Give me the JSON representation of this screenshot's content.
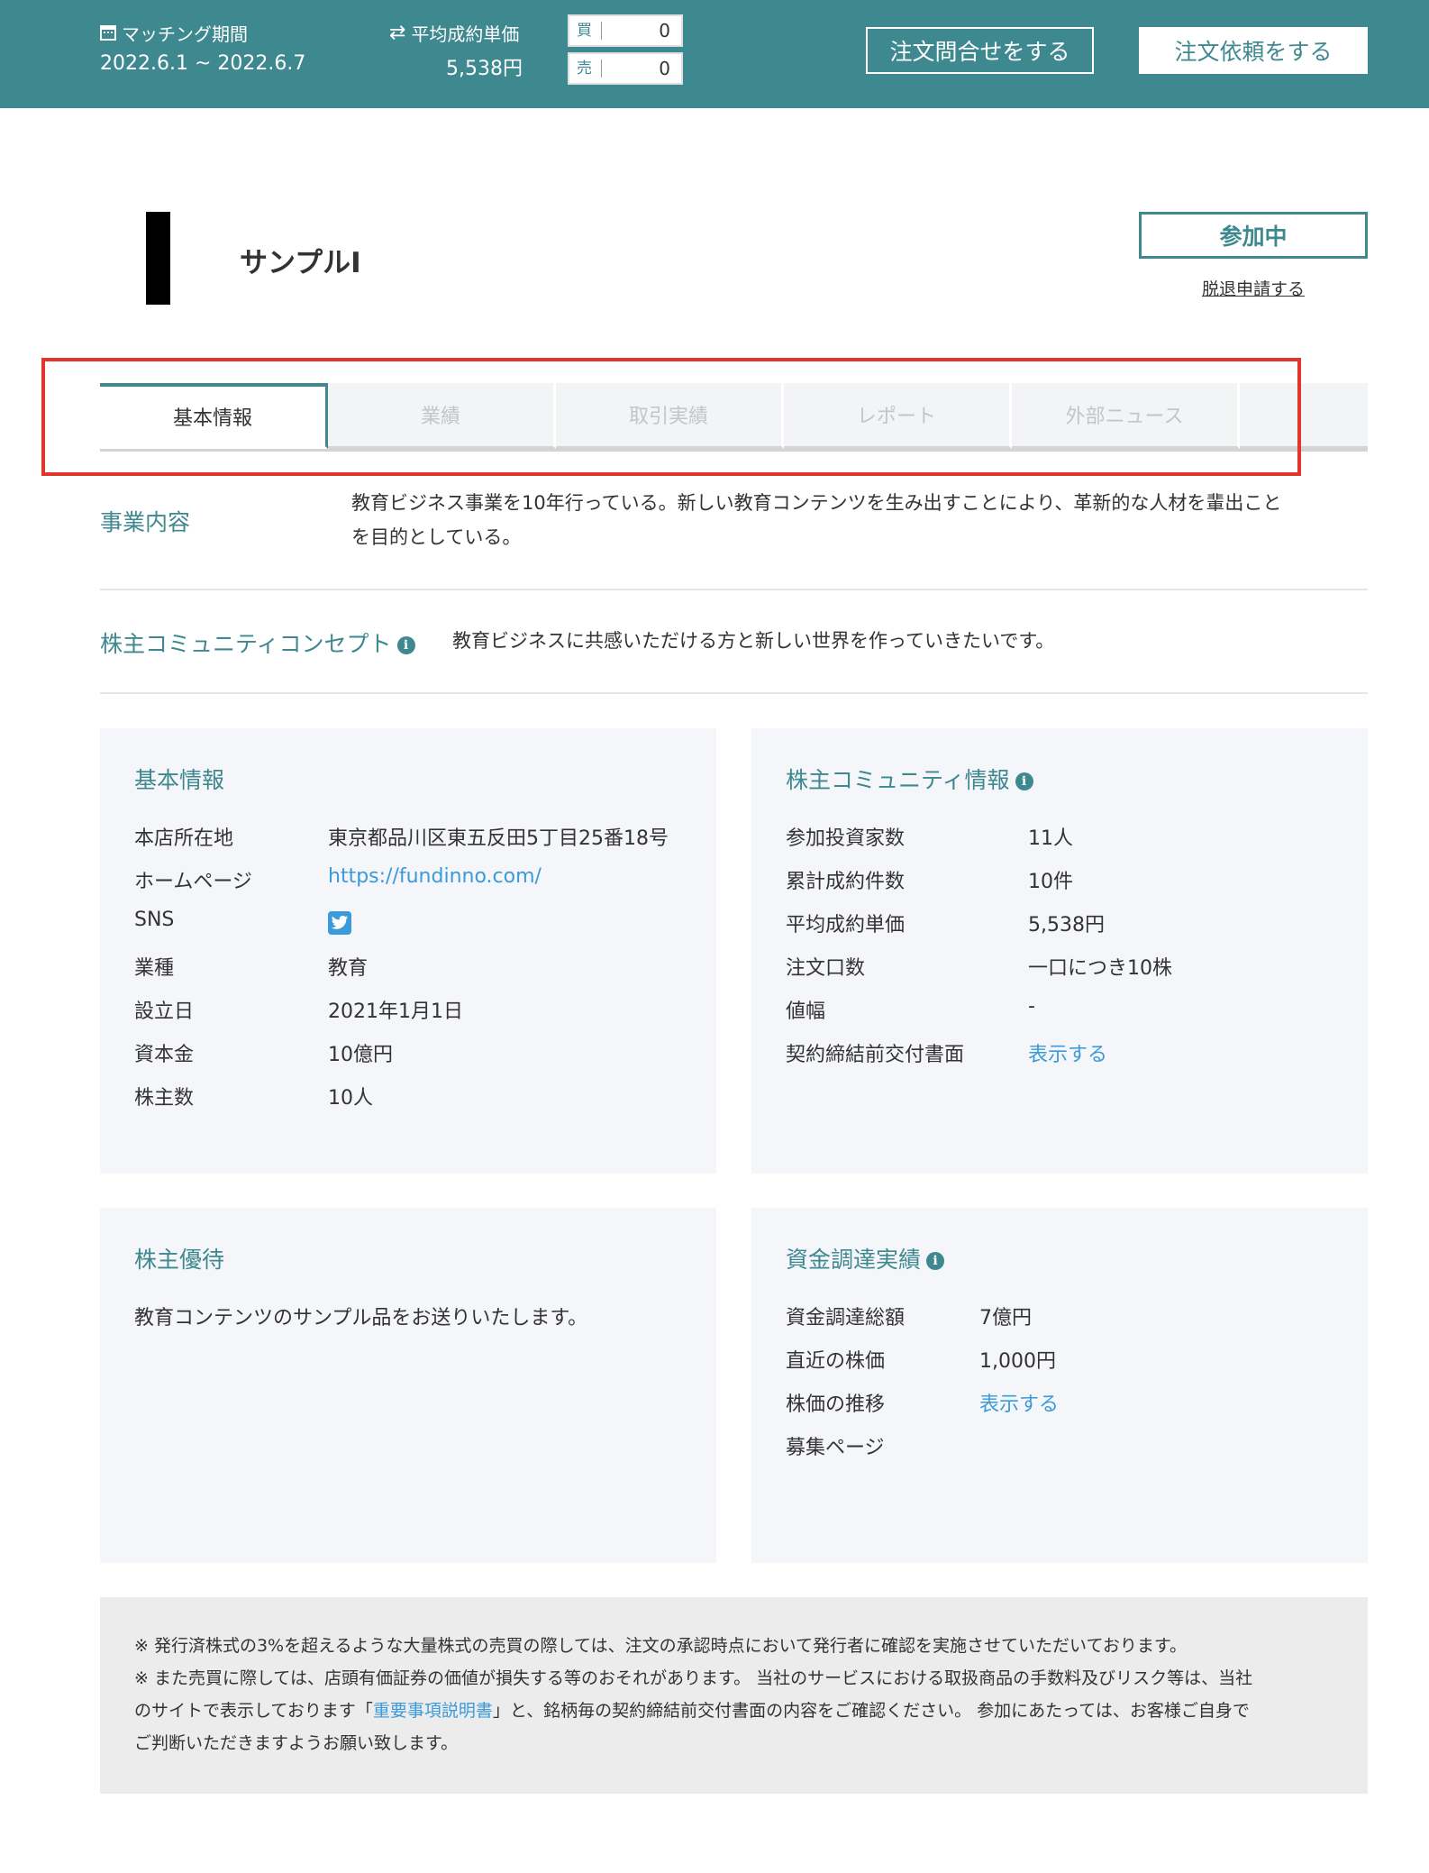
{
  "topbar": {
    "matching_label": "マッチング期間",
    "matching_value": "2022.6.1 ~ 2022.6.7",
    "avg_price_label": "平均成約単価",
    "avg_price_value": "5,538円",
    "buy_label": "買",
    "buy_value": "0",
    "sell_label": "売",
    "sell_value": "0",
    "inquiry_button": "注文問合せをする",
    "order_button": "注文依頼をする",
    "bg_color": "#3e8890"
  },
  "company": {
    "name": "サンプルI",
    "joined_button": "参加中",
    "withdraw_link": "脱退申請する"
  },
  "tabs": [
    {
      "label": "基本情報",
      "active": true
    },
    {
      "label": "業績",
      "active": false
    },
    {
      "label": "取引実績",
      "active": false
    },
    {
      "label": "レポート",
      "active": false
    },
    {
      "label": "外部ニュース",
      "active": false
    },
    {
      "label": "",
      "active": false
    }
  ],
  "business": {
    "label": "事業内容",
    "text_line1": "教育ビジネス事業を10年行っている。新しい教育コンテンツを生み出すことにより、革新的な人材を輩出こと",
    "text_line2": "を目的としている。"
  },
  "community_concept": {
    "label": "株主コミュニティコンセプト",
    "text": "教育ビジネスに共感いただける方と新しい世界を作っていきたいです。"
  },
  "basic_info": {
    "title": "基本情報",
    "rows": [
      {
        "key": "本店所在地",
        "value": "東京都品川区東五反田5丁目25番18号"
      },
      {
        "key": "ホームページ",
        "value": "https://fundinno.com/"
      },
      {
        "key": "SNS",
        "value": ""
      },
      {
        "key": "業種",
        "value": "教育"
      },
      {
        "key": "設立日",
        "value": "2021年1月1日"
      },
      {
        "key": "資本金",
        "value": "10億円"
      },
      {
        "key": "株主数",
        "value": "10人"
      }
    ]
  },
  "community_info": {
    "title": "株主コミュニティ情報",
    "rows": [
      {
        "key": "参加投資家数",
        "value": "11人"
      },
      {
        "key": "累計成約件数",
        "value": "10件"
      },
      {
        "key": "平均成約単価",
        "value": "5,538円"
      },
      {
        "key": "注文口数",
        "value": "一口につき10株"
      },
      {
        "key": "値幅",
        "value": "-"
      },
      {
        "key": "契約締結前交付書面",
        "value": "表示する"
      }
    ]
  },
  "benefits": {
    "title": "株主優待",
    "text": "教育コンテンツのサンプル品をお送りいたします。"
  },
  "funding": {
    "title": "資金調達実績",
    "rows": [
      {
        "key": "資金調達総額",
        "value": "7億円"
      },
      {
        "key": "直近の株価",
        "value": "1,000円"
      },
      {
        "key": "株価の推移",
        "value": "表示する"
      },
      {
        "key": "募集ページ",
        "value": ""
      }
    ]
  },
  "notice": {
    "line1": "※ 発行済株式の3%を超えるような大量株式の売買の際しては、注文の承認時点において発行者に確認を実施させていただいております。",
    "line2": "※ また売買に際しては、店頭有価証券の価値が損失する等のおそれがあります。 当社のサービスにおける取扱商品の手数料及びリスク等は、当社",
    "line3_pre": "のサイトで表示しております「",
    "line3_link": "重要事項説明書",
    "line3_post": "」と、銘柄毎の契約締結前交付書面の内容をご確認ください。 参加にあたっては、お客様ご自身で",
    "line4": "ご判断いただきますようお願い致します。"
  }
}
